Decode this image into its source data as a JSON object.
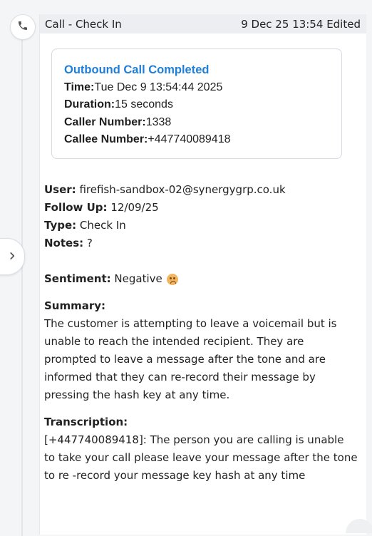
{
  "header": {
    "title": "Call - Check In",
    "timestamp": "9 Dec 25 13:54",
    "status": "Edited"
  },
  "call_card": {
    "heading": "Outbound Call Completed",
    "rows": [
      {
        "label": "Time:",
        "value": "Tue Dec 9 13:54:44 2025"
      },
      {
        "label": "Duration:",
        "value": "15 seconds"
      },
      {
        "label": "Caller Number:",
        "value": "1338"
      },
      {
        "label": "Callee Number:",
        "value": "+447740089418"
      }
    ]
  },
  "details": [
    {
      "label": "User:",
      "value": "firefish-sandbox-02@synergygrp.co.uk"
    },
    {
      "label": "Follow Up:",
      "value": "12/09/25"
    },
    {
      "label": "Type:",
      "value": "Check In"
    },
    {
      "label": "Notes:",
      "value": "?"
    }
  ],
  "sentiment": {
    "label": "Sentiment:",
    "value": "Negative",
    "icon": "sad-face-emoji"
  },
  "summary": {
    "label": "Summary:",
    "text": "The customer is attempting to leave a voicemail but is unable to reach the intended recipient. They are prompted to leave a message after the tone and are informed that they can re-record their message by pressing the hash key at any time."
  },
  "transcription": {
    "label": "Transcription:",
    "text": "[+447740089418]: The person you are calling is unable to take your call please leave your message after the tone to re -record your message key hash at any time"
  },
  "icons": {
    "badge": "phone-icon",
    "toggle": "chevron-right-icon"
  },
  "colors": {
    "accent": "#1e7fd8",
    "header_bg": "#eceef1"
  }
}
